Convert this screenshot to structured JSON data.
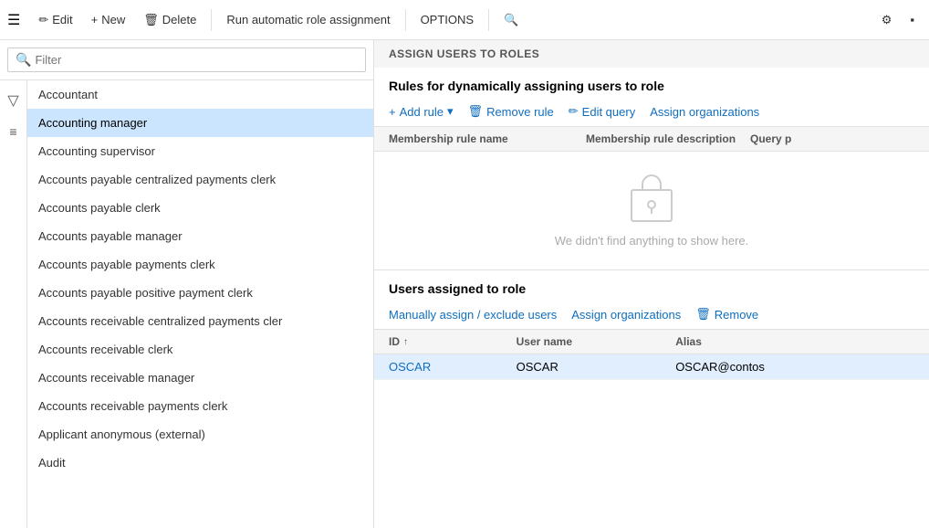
{
  "toolbar": {
    "hamburger": "☰",
    "buttons": [
      {
        "label": "Edit",
        "icon": "✏"
      },
      {
        "label": "New",
        "icon": "+"
      },
      {
        "label": "Delete",
        "icon": "🗑"
      },
      {
        "label": "Run automatic role assignment",
        "icon": ""
      },
      {
        "label": "OPTIONS",
        "icon": ""
      }
    ],
    "search_icon": "🔍",
    "gear_icon": "⚙",
    "app_icon": "▪"
  },
  "sidebar": {
    "filter_placeholder": "Filter",
    "items": [
      {
        "label": "Accountant",
        "selected": false
      },
      {
        "label": "Accounting manager",
        "selected": true
      },
      {
        "label": "Accounting supervisor",
        "selected": false
      },
      {
        "label": "Accounts payable centralized payments clerk",
        "selected": false
      },
      {
        "label": "Accounts payable clerk",
        "selected": false
      },
      {
        "label": "Accounts payable manager",
        "selected": false
      },
      {
        "label": "Accounts payable payments clerk",
        "selected": false
      },
      {
        "label": "Accounts payable positive payment clerk",
        "selected": false
      },
      {
        "label": "Accounts receivable centralized payments cler",
        "selected": false
      },
      {
        "label": "Accounts receivable clerk",
        "selected": false
      },
      {
        "label": "Accounts receivable manager",
        "selected": false
      },
      {
        "label": "Accounts receivable payments clerk",
        "selected": false
      },
      {
        "label": "Applicant anonymous (external)",
        "selected": false
      },
      {
        "label": "Audit",
        "selected": false
      }
    ]
  },
  "rules_section": {
    "header": "ASSIGN USERS TO ROLES",
    "title": "Rules for dynamically assigning users to role",
    "actions": [
      {
        "label": "Add rule",
        "icon": "+",
        "has_dropdown": true,
        "disabled": false
      },
      {
        "label": "Remove rule",
        "icon": "🗑",
        "disabled": false
      },
      {
        "label": "Edit query",
        "icon": "✏",
        "disabled": false
      },
      {
        "label": "Assign organizations",
        "icon": "",
        "disabled": false
      }
    ],
    "table": {
      "columns": [
        "Membership rule name",
        "Membership rule description",
        "Query p"
      ],
      "empty_message": "We didn't find anything to show here."
    }
  },
  "users_section": {
    "title": "Users assigned to role",
    "actions": [
      {
        "label": "Manually assign / exclude users",
        "icon": "",
        "disabled": false
      },
      {
        "label": "Assign organizations",
        "icon": "",
        "disabled": false
      },
      {
        "label": "Remove",
        "icon": "🗑",
        "disabled": false
      }
    ],
    "table": {
      "columns": [
        {
          "label": "ID",
          "sort": "↑"
        },
        {
          "label": "User name",
          "sort": ""
        },
        {
          "label": "Alias",
          "sort": ""
        }
      ],
      "rows": [
        {
          "id": "OSCAR",
          "username": "OSCAR",
          "alias": "OSCAR@contos"
        }
      ]
    }
  }
}
